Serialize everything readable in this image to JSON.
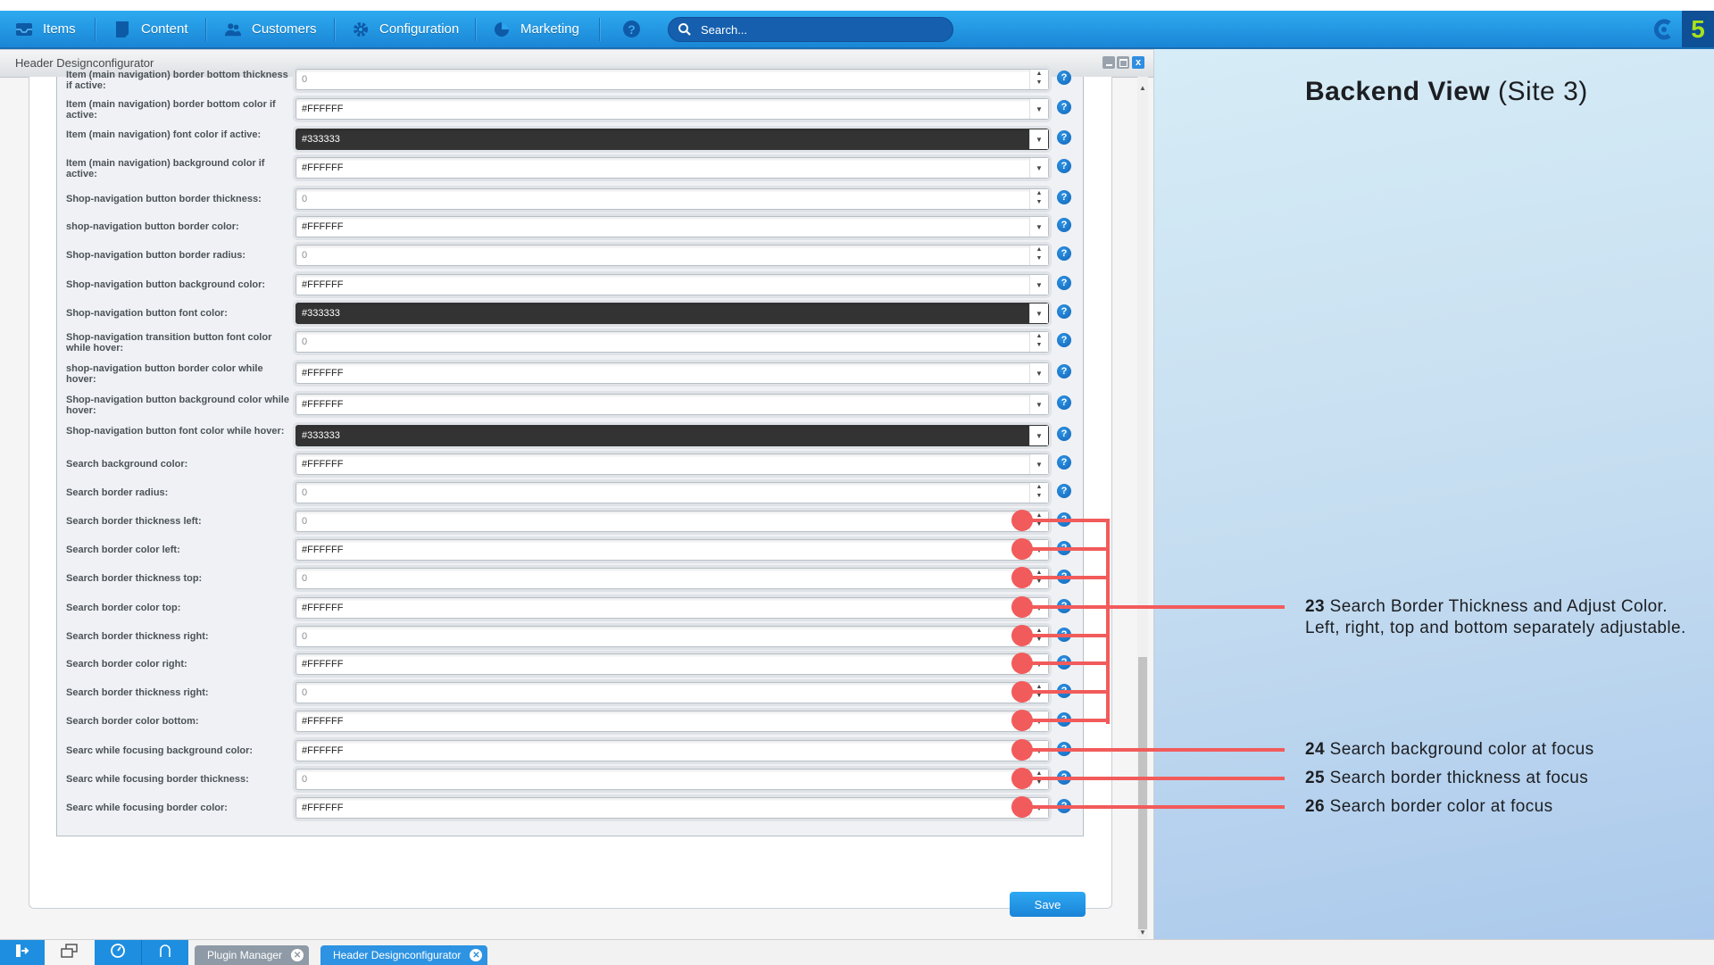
{
  "topnav": {
    "items": [
      {
        "label": "Items",
        "icon": "inbox-icon"
      },
      {
        "label": "Content",
        "icon": "document-icon"
      },
      {
        "label": "Customers",
        "icon": "users-icon"
      },
      {
        "label": "Configuration",
        "icon": "gear-icon"
      },
      {
        "label": "Marketing",
        "icon": "pie-chart-icon"
      }
    ],
    "help_icon": "?",
    "search_placeholder": "Search...",
    "logo_text": "5"
  },
  "window": {
    "title": "Header Designconfigurator",
    "controls": {
      "minimize": "_",
      "maximize": "□",
      "close": "x"
    },
    "rows": [
      {
        "label": "Item (main navigation) border bottom thickness if active:",
        "value": "0",
        "type": "number"
      },
      {
        "label": "Item (main navigation) border bottom color if active:",
        "value": "#FFFFFF",
        "type": "color"
      },
      {
        "label": "Item (main navigation) font color if active:",
        "value": "#333333",
        "type": "color-dark"
      },
      {
        "label": "Item (main navigation) background color if active:",
        "value": "#FFFFFF",
        "type": "color"
      },
      {
        "label": "Shop-navigation button border thickness:",
        "value": "0",
        "type": "number"
      },
      {
        "label": "shop-navigation button border color:",
        "value": "#FFFFFF",
        "type": "color"
      },
      {
        "label": "Shop-navigation button border radius:",
        "value": "0",
        "type": "number"
      },
      {
        "label": "Shop-navigation button background color:",
        "value": "#FFFFFF",
        "type": "color"
      },
      {
        "label": "Shop-navigation button font color:",
        "value": "#333333",
        "type": "color-dark"
      },
      {
        "label": "Shop-navigation transition button font color while hover:",
        "value": "0",
        "type": "number"
      },
      {
        "label": "shop-navigation button border color while hover:",
        "value": "#FFFFFF",
        "type": "color"
      },
      {
        "label": "Shop-navigation button background color while hover:",
        "value": "#FFFFFF",
        "type": "color"
      },
      {
        "label": "Shop-navigation button font color while hover:",
        "value": "#333333",
        "type": "color-dark"
      },
      {
        "label": "Search background color:",
        "value": "#FFFFFF",
        "type": "color"
      },
      {
        "label": "Search border radius:",
        "value": "0",
        "type": "number"
      },
      {
        "label": "Search border thickness left:",
        "value": "0",
        "type": "number"
      },
      {
        "label": "Search border color left:",
        "value": "#FFFFFF",
        "type": "color"
      },
      {
        "label": "Search border thickness top:",
        "value": "0",
        "type": "number"
      },
      {
        "label": "Search border color top:",
        "value": "#FFFFFF",
        "type": "color"
      },
      {
        "label": "Search border thickness right:",
        "value": "0",
        "type": "number"
      },
      {
        "label": "Search border color right:",
        "value": "#FFFFFF",
        "type": "color"
      },
      {
        "label": "Search border thickness right:",
        "value": "0",
        "type": "number"
      },
      {
        "label": "Search border color bottom:",
        "value": "#FFFFFF",
        "type": "color"
      },
      {
        "label": "Searc while focusing background color:",
        "value": "#FFFFFF",
        "type": "color"
      },
      {
        "label": "Searc while focusing border thickness:",
        "value": "0",
        "type": "number"
      },
      {
        "label": "Searc while focusing border color:",
        "value": "#FFFFFF",
        "type": "color"
      }
    ],
    "save_label": "Save"
  },
  "annotations": {
    "title_bold": "Backend View",
    "title_rest": " (Site 3)",
    "notes": [
      {
        "num": "23",
        "text": " Search Border Thickness and Adjust Color. Left, right, top and bottom separately adjustable."
      },
      {
        "num": "24",
        "text": " Search background color at focus"
      },
      {
        "num": "25",
        "text": " Search border thickness at focus"
      },
      {
        "num": "26",
        "text": " Search border color at focus"
      }
    ],
    "accent_color": "#F25B5B"
  },
  "taskbar": {
    "tabs": [
      {
        "label": "Plugin Manager",
        "active": false
      },
      {
        "label": "Header Designconfigurator",
        "active": true
      }
    ]
  }
}
